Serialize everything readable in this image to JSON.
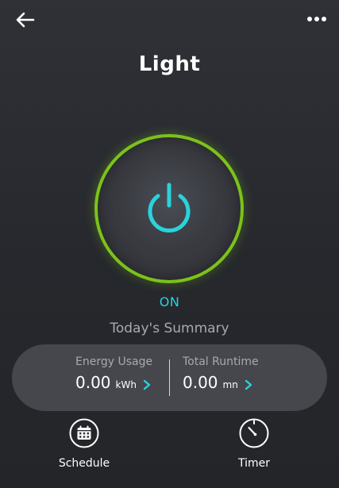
{
  "header": {
    "title": "Light",
    "back_icon": "arrow-left-icon",
    "more_icon": "more-horizontal-icon"
  },
  "power": {
    "icon": "power-icon",
    "state": "ON",
    "ring_color": "#7cc21a",
    "accent_color": "#29d3dc"
  },
  "summary": {
    "title": "Today's Summary",
    "energy": {
      "label": "Energy Usage",
      "value": "0.00",
      "unit": "kWh"
    },
    "runtime": {
      "label": "Total Runtime",
      "value": "0.00",
      "unit": "mn"
    }
  },
  "actions": {
    "schedule": {
      "label": "Schedule",
      "icon": "calendar-icon"
    },
    "timer": {
      "label": "Timer",
      "icon": "timer-icon"
    }
  }
}
